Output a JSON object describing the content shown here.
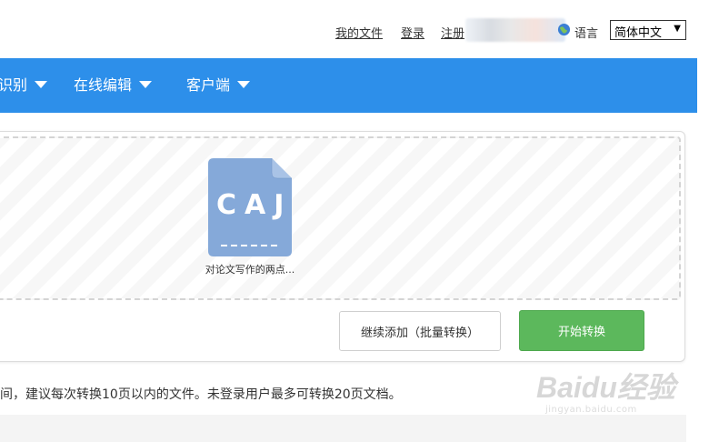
{
  "topbar": {
    "my_files": "我的文件",
    "login": "登录",
    "register": "注册",
    "language_label": "语言",
    "language_selected": "简体中文",
    "language_arrow": "▼"
  },
  "nav": {
    "items": [
      {
        "label": "识别"
      },
      {
        "label": "在线编辑"
      },
      {
        "label": "客户端"
      }
    ]
  },
  "upload": {
    "file": {
      "type_label": "CAJ",
      "name": "对论文写作的两点..."
    },
    "add_more_button": "继续添加（批量转换）",
    "start_button": "开始转换"
  },
  "notice": "间，建议每次转换10页以内的文件。未登录用户最多可转换20页文档。",
  "watermark": {
    "text": "Baidu经验",
    "url": "jingyan.baidu.com"
  },
  "colors": {
    "nav_bg": "#2d8fea",
    "start_button_bg": "#5cb85c",
    "file_icon": "#85a9d9"
  }
}
